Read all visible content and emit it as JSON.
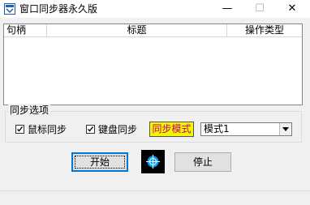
{
  "window": {
    "title": "窗口同步器永久版",
    "minimize_glyph": "—",
    "maximize_glyph": "☐",
    "close_glyph": "✕"
  },
  "list": {
    "columns": [
      "句柄",
      "标题",
      "操作类型"
    ]
  },
  "sync_options": {
    "group_label": "同步选项",
    "mouse_sync_label": "鼠标同步",
    "mouse_sync_checked": true,
    "keyboard_sync_label": "键盘同步",
    "keyboard_sync_checked": true,
    "mode_label": "同步模式",
    "mode_value": "模式1"
  },
  "buttons": {
    "start": "开始",
    "stop": "停止"
  },
  "colors": {
    "mode_bg": "#f5f500",
    "mode_text": "#c00080",
    "target_bg": "#000000",
    "target_fg": "#00a0ff"
  },
  "icons": {
    "app": "app-icon",
    "target": "crosshair-icon"
  }
}
